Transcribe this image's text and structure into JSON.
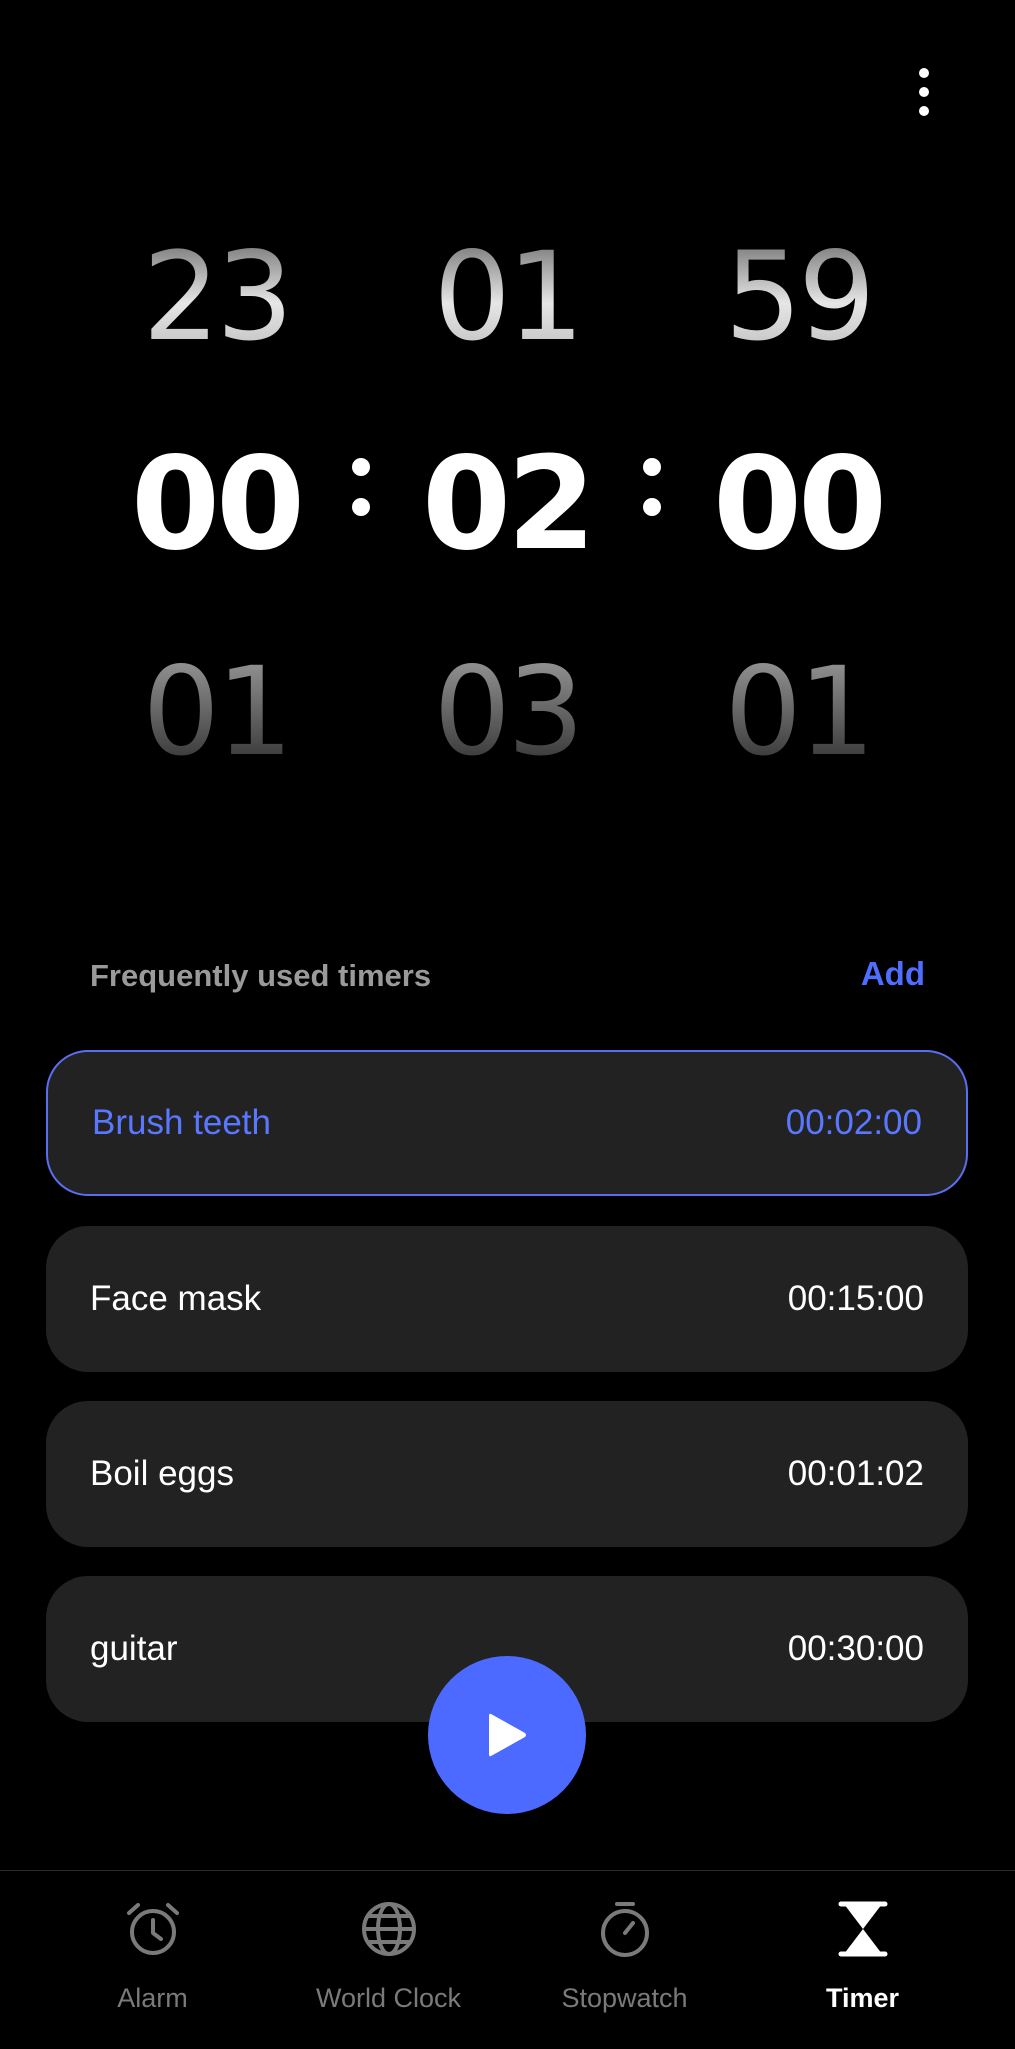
{
  "header": {
    "more_options_icon": "more-vertical-icon"
  },
  "picker": {
    "hours": {
      "prev": "23",
      "current": "00",
      "next": "01"
    },
    "minutes": {
      "prev": "01",
      "current": "02",
      "next": "03"
    },
    "seconds": {
      "prev": "59",
      "current": "00",
      "next": "01"
    },
    "separator": ":"
  },
  "frequent": {
    "title": "Frequently used timers",
    "add_label": "Add",
    "timers": [
      {
        "name": "Brush teeth",
        "time": "00:02:00",
        "selected": true
      },
      {
        "name": "Face mask",
        "time": "00:15:00",
        "selected": false
      },
      {
        "name": "Boil eggs",
        "time": "00:01:02",
        "selected": false
      },
      {
        "name": "guitar",
        "time": "00:30:00",
        "selected": false
      }
    ]
  },
  "play_button": {
    "icon": "play-icon"
  },
  "nav": {
    "items": [
      {
        "label": "Alarm",
        "icon": "alarm-clock-icon",
        "active": false
      },
      {
        "label": "World Clock",
        "icon": "globe-icon",
        "active": false
      },
      {
        "label": "Stopwatch",
        "icon": "stopwatch-icon",
        "active": false
      },
      {
        "label": "Timer",
        "icon": "hourglass-icon",
        "active": true
      }
    ]
  },
  "colors": {
    "accent": "#4c6aff",
    "selected_text": "#5a78ff",
    "card_bg": "#222222",
    "background": "#000000"
  }
}
